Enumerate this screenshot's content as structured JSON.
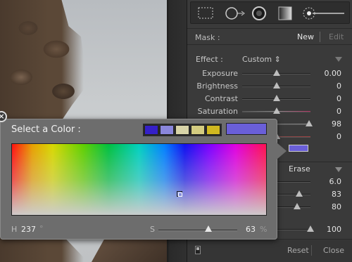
{
  "toolbar": {
    "tools": [
      "crop-overlay-icon",
      "spot-removal-icon",
      "red-eye-icon",
      "graduated-filter-icon",
      "adjustment-brush-icon"
    ]
  },
  "mask": {
    "label": "Mask :",
    "new": "New",
    "edit": "Edit"
  },
  "effect": {
    "label": "Effect :",
    "value": "Custom ⇕"
  },
  "sliders": [
    {
      "label": "Exposure",
      "value": "0.00",
      "level": 0.5
    },
    {
      "label": "Brightness",
      "value": "0",
      "level": 0.5
    },
    {
      "label": "Contrast",
      "value": "0",
      "level": 0.5
    },
    {
      "label": "Saturation",
      "value": "0",
      "level": 0.5
    },
    {
      "label": "",
      "value": "98",
      "level": 0.98
    },
    {
      "label": "",
      "value": "0",
      "level": 0.5
    }
  ],
  "mask_color": "#6a5fd8",
  "erase": {
    "label": "Erase"
  },
  "brush_values": [
    {
      "label": "",
      "value": "6.0",
      "level": 0.3
    },
    {
      "label": "",
      "value": "83",
      "level": 0.83
    },
    {
      "label": "",
      "value": "80",
      "level": 0.8
    },
    {
      "label": "k",
      "value": "100",
      "level": 1.0
    }
  ],
  "bottom": {
    "reset": "Reset",
    "close": "Close"
  },
  "picker": {
    "title": "Select a Color :",
    "close_glyph": "×",
    "presets": [
      "#3520c8",
      "#8a86dc",
      "#d8d4a8",
      "#d4cc80",
      "#d0b820"
    ],
    "current_color": "#6a5fd8",
    "hue_label": "H",
    "hue_value": "237",
    "hue_unit": "°",
    "sat_label": "S",
    "sat_value": "63",
    "sat_unit": "%",
    "sat_level": 0.63
  }
}
